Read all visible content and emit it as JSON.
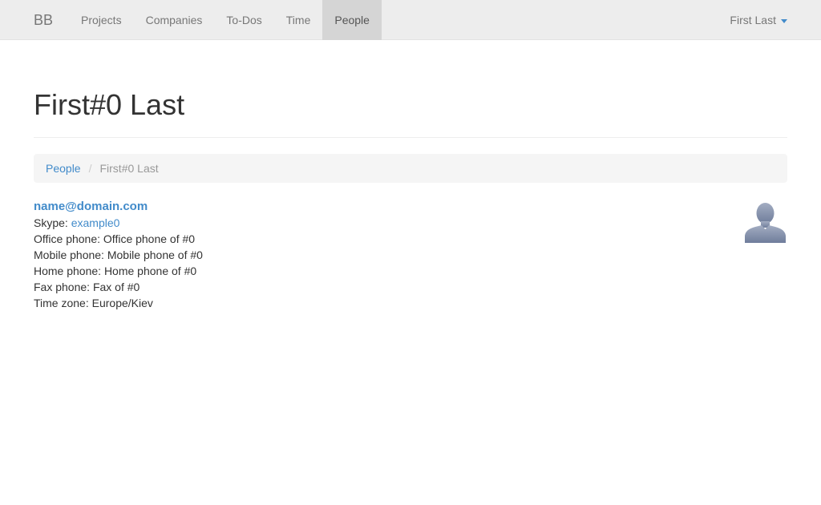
{
  "navbar": {
    "brand": "BB",
    "items": [
      {
        "label": "Projects"
      },
      {
        "label": "Companies"
      },
      {
        "label": "To-Dos"
      },
      {
        "label": "Time"
      },
      {
        "label": "People",
        "active": true
      }
    ],
    "user": "First Last"
  },
  "page": {
    "title": "First#0 Last"
  },
  "breadcrumb": {
    "parent": "People",
    "current": "First#0 Last"
  },
  "profile": {
    "email": "name@domain.com",
    "skype_label": "Skype: ",
    "skype_value": "example0",
    "office_phone": "Office phone: Office phone of #0",
    "mobile_phone": "Mobile phone: Mobile phone of #0",
    "home_phone": "Home phone: Home phone of #0",
    "fax_phone": "Fax phone: Fax of #0",
    "time_zone": "Time zone: Europe/Kiev",
    "avatar_icon": "user-silhouette-icon"
  },
  "colors": {
    "navbar_bg": "#ededed",
    "active_tab_bg": "#d5d5d5",
    "link": "#428bca",
    "breadcrumb_bg": "#f5f5f5",
    "avatar": "#7a87a3"
  }
}
